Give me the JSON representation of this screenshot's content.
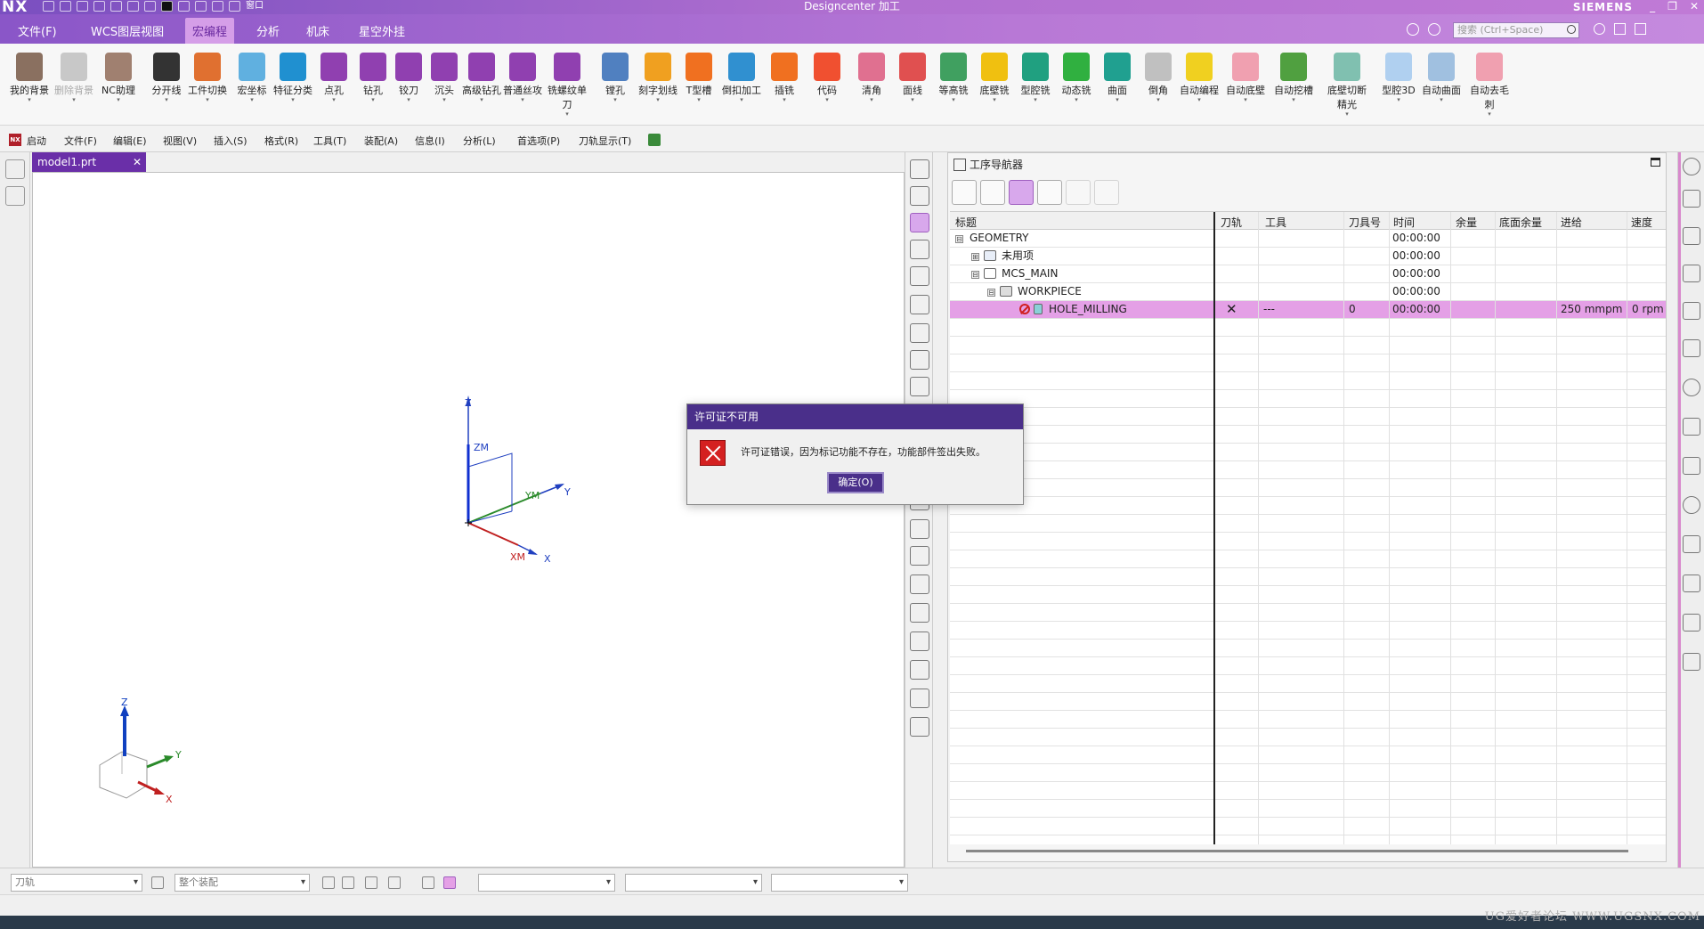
{
  "titlebar": {
    "logo": "NX",
    "window_menu": "窗口",
    "title": "Designcenter 加工",
    "brand": "SIEMENS",
    "controls": [
      "_",
      "❐",
      "✕"
    ]
  },
  "menu": {
    "tabs": [
      "文件(F)",
      "WCS图层视图",
      "宏编程",
      "分析",
      "机床",
      "星空外挂"
    ],
    "active_tab": "宏编程",
    "search_placeholder": "搜索 (Ctrl+Space)"
  },
  "ribbon": {
    "buttons": [
      {
        "label": "我的背景",
        "color": "#8a7060"
      },
      {
        "label": "删除背景",
        "color": "#c8c8c8",
        "disabled": true
      },
      {
        "label": "NC助理",
        "color": "#a08070"
      },
      {
        "label": "分开线",
        "color": "#333333"
      },
      {
        "label": "工件切换",
        "color": "#e07030"
      },
      {
        "label": "宏坐标",
        "color": "#60b0e0"
      },
      {
        "label": "特征分类",
        "color": "#2090d0"
      },
      {
        "label": "点孔",
        "color": "#9040b0"
      },
      {
        "label": "钻孔",
        "color": "#9040b0"
      },
      {
        "label": "铰刀",
        "color": "#9040b0"
      },
      {
        "label": "沉头",
        "color": "#9040b0"
      },
      {
        "label": "高级钻孔",
        "color": "#9040b0"
      },
      {
        "label": "普通丝攻",
        "color": "#9040b0"
      },
      {
        "label": "铣螺纹单刀",
        "color": "#9040b0"
      },
      {
        "label": "镗孔",
        "color": "#5080c0"
      },
      {
        "label": "刻字划线",
        "color": "#f0a020"
      },
      {
        "label": "T型槽",
        "color": "#f07020"
      },
      {
        "label": "倒扣加工",
        "color": "#3090d0"
      },
      {
        "label": "插铣",
        "color": "#f07020"
      },
      {
        "label": "代码",
        "color": "#f05030"
      },
      {
        "label": "清角",
        "color": "#e07090"
      },
      {
        "label": "面线",
        "color": "#e05050"
      },
      {
        "label": "等高铣",
        "color": "#40a060"
      },
      {
        "label": "底壁铣",
        "color": "#f0c010"
      },
      {
        "label": "型腔铣",
        "color": "#20a080"
      },
      {
        "label": "动态铣",
        "color": "#30b040"
      },
      {
        "label": "曲面",
        "color": "#20a090"
      },
      {
        "label": "倒角",
        "color": "#c0c0c0"
      },
      {
        "label": "自动编程",
        "color": "#f0d020"
      },
      {
        "label": "自动底壁",
        "color": "#f0a0b0"
      },
      {
        "label": "自动挖槽",
        "color": "#50a040"
      },
      {
        "label": "底壁切断精光",
        "color": "#80c0b0"
      },
      {
        "label": "型腔3D",
        "color": "#b0d0f0"
      },
      {
        "label": "自动曲面",
        "color": "#a0c0e0"
      },
      {
        "label": "自动去毛刺",
        "color": "#f0a0b0"
      }
    ]
  },
  "cmdbar": {
    "items": [
      "启动",
      "文件(F)",
      "编辑(E)",
      "视图(V)",
      "插入(S)",
      "格式(R)",
      "工具(T)",
      "装配(A)",
      "信息(I)",
      "分析(L)",
      "首选项(P)",
      "刀轨显示(T)"
    ]
  },
  "document": {
    "tab_label": "model1.prt",
    "close": "✕"
  },
  "axes": {
    "z": "Z",
    "zm": "ZM",
    "y": "Y",
    "ym": "YM",
    "x": "X",
    "xm": "XM"
  },
  "navigator": {
    "title": "工序导航器",
    "columns": [
      "标题",
      "刀轨",
      "工具",
      "刀具号",
      "时间",
      "余量",
      "底面余量",
      "进给",
      "速度"
    ],
    "rows": [
      {
        "name": "GEOMETRY",
        "expander": "⊟",
        "time": "00:00:00"
      },
      {
        "name": "未用项",
        "expander": "⊞",
        "time": "00:00:00"
      },
      {
        "name": "MCS_MAIN",
        "expander": "⊟",
        "time": "00:00:00"
      },
      {
        "name": "WORKPIECE",
        "expander": "⊟",
        "time": "00:00:00"
      },
      {
        "name": "HOLE_MILLING",
        "path": "✕",
        "tool": "---",
        "tool_no": "0",
        "time": "00:00:00",
        "feed": "250 mmpm",
        "speed": "0 rpm"
      }
    ]
  },
  "bottombar": {
    "filter1": "刀轨",
    "filter2": "整个装配"
  },
  "dialog": {
    "title": "许可证不可用",
    "message": "许可证错误，因为标记功能不存在，功能部件签出失败。",
    "ok_label": "确定(O)"
  },
  "watermark": "UG爱好者论坛 WWW.UGSNX.COM"
}
